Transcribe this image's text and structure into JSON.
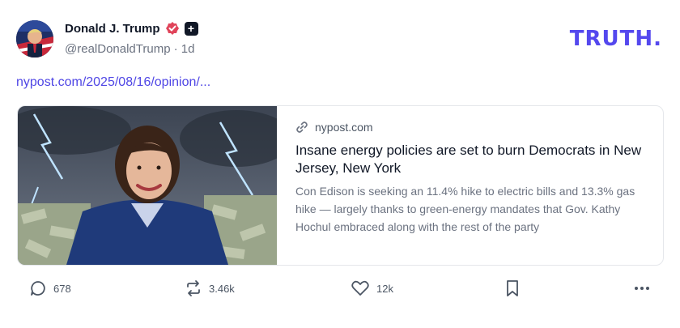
{
  "author": {
    "name": "Donald J. Trump",
    "handle": "@realDonaldTrump",
    "time": "· 1d",
    "verified_icon": "verified-check-icon",
    "plus_badge": "+"
  },
  "brand": {
    "logo_text": "TRUTH",
    "logo_dot": ".",
    "accent": "#5448ee"
  },
  "post": {
    "link_text": "nypost.com/2025/08/16/opinion/..."
  },
  "link_card": {
    "domain": "nypost.com",
    "title": "Insane energy policies are set to burn Democrats in New Jersey, New York",
    "description": "Con Edison is seeking an 11.4% hike to electric bills and 13.3% gas hike — largely thanks to green-energy mandates that Gov. Kathy Hochul embraced along with the rest of the party"
  },
  "actions": {
    "replies": "678",
    "retruths": "3.46k",
    "likes": "12k"
  },
  "colors": {
    "link": "#4f46e5",
    "verified": "#e0445a",
    "text_muted": "#6b7280"
  }
}
